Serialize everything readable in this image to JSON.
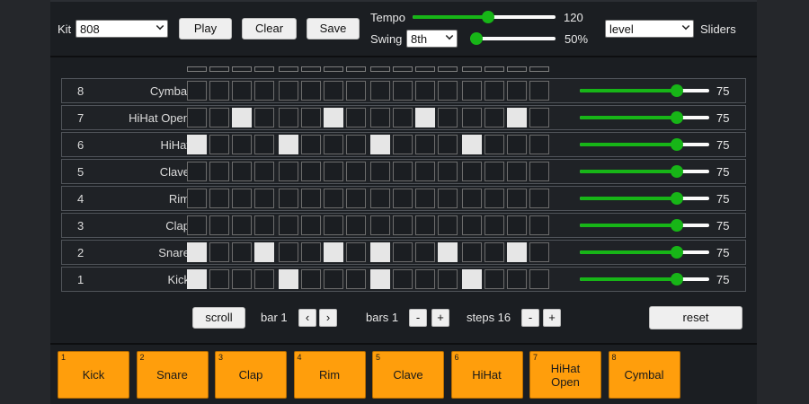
{
  "header": {
    "kit_label": "Kit",
    "kit_value": "808",
    "play_label": "Play",
    "clear_label": "Clear",
    "save_label": "Save",
    "tempo_label": "Tempo",
    "tempo_value": "120",
    "tempo_level": 0.53,
    "swing_label": "Swing",
    "swing_select": "8th",
    "swing_value": "50%",
    "swing_level": 0.0,
    "mode_select": "level",
    "sliders_label": "Sliders"
  },
  "tracks": [
    {
      "num": "8",
      "name": "Cymbal",
      "level": "75",
      "steps": [
        0,
        0,
        0,
        0,
        0,
        0,
        0,
        0,
        0,
        0,
        0,
        0,
        0,
        0,
        0,
        0
      ]
    },
    {
      "num": "7",
      "name": "HiHat Open",
      "level": "75",
      "steps": [
        0,
        0,
        1,
        0,
        0,
        0,
        1,
        0,
        0,
        0,
        1,
        0,
        0,
        0,
        1,
        0
      ]
    },
    {
      "num": "6",
      "name": "HiHat",
      "level": "75",
      "steps": [
        1,
        0,
        0,
        0,
        1,
        0,
        0,
        0,
        1,
        0,
        0,
        0,
        1,
        0,
        0,
        0
      ]
    },
    {
      "num": "5",
      "name": "Clave",
      "level": "75",
      "steps": [
        0,
        0,
        0,
        0,
        0,
        0,
        0,
        0,
        0,
        0,
        0,
        0,
        0,
        0,
        0,
        0
      ]
    },
    {
      "num": "4",
      "name": "Rim",
      "level": "75",
      "steps": [
        0,
        0,
        0,
        0,
        0,
        0,
        0,
        0,
        0,
        0,
        0,
        0,
        0,
        0,
        0,
        0
      ]
    },
    {
      "num": "3",
      "name": "Clap",
      "level": "75",
      "steps": [
        0,
        0,
        0,
        0,
        0,
        0,
        0,
        0,
        0,
        0,
        0,
        0,
        0,
        0,
        0,
        0
      ]
    },
    {
      "num": "2",
      "name": "Snare",
      "level": "75",
      "steps": [
        1,
        0,
        0,
        1,
        0,
        0,
        1,
        0,
        1,
        0,
        0,
        1,
        0,
        0,
        1,
        0
      ]
    },
    {
      "num": "1",
      "name": "Kick",
      "level": "75",
      "steps": [
        1,
        0,
        0,
        0,
        1,
        0,
        0,
        0,
        1,
        0,
        0,
        0,
        1,
        0,
        0,
        0
      ]
    }
  ],
  "controls": {
    "scroll_label": "scroll",
    "bar_label": "bar 1",
    "prev_label": "‹",
    "next_label": "›",
    "bars_label": "bars 1",
    "steps_label": "steps 16",
    "minus_label": "-",
    "plus_label": "+",
    "reset_label": "reset"
  },
  "pads": [
    {
      "num": "1",
      "label": "Kick"
    },
    {
      "num": "2",
      "label": "Snare"
    },
    {
      "num": "3",
      "label": "Clap"
    },
    {
      "num": "4",
      "label": "Rim"
    },
    {
      "num": "5",
      "label": "Clave"
    },
    {
      "num": "6",
      "label": "HiHat"
    },
    {
      "num": "7",
      "label": "HiHat Open"
    },
    {
      "num": "8",
      "label": "Cymbal"
    }
  ],
  "colors": {
    "slider_green": "#17b517",
    "pad_orange": "#ff9e0c",
    "step_on": "#e6e6e6"
  }
}
